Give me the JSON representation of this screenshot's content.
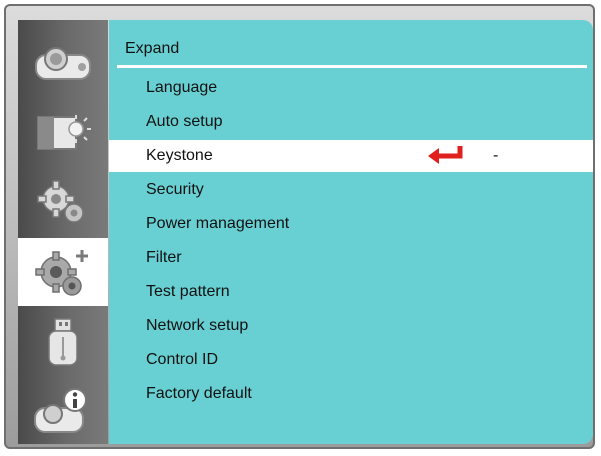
{
  "colors": {
    "panel": "#68d0d3",
    "selection": "#ffffff",
    "sidebar": "#5a5a5a",
    "enter_arrow": "#e0201c"
  },
  "sidebar": {
    "items": [
      {
        "icon": "projector-icon",
        "active": false
      },
      {
        "icon": "picture-adjust-icon",
        "active": false
      },
      {
        "icon": "settings-gear-icon",
        "active": false
      },
      {
        "icon": "expand-settings-icon",
        "active": true
      },
      {
        "icon": "usb-icon",
        "active": false
      },
      {
        "icon": "info-icon",
        "active": false
      }
    ]
  },
  "menu": {
    "title": "Expand",
    "items": [
      {
        "label": "Language"
      },
      {
        "label": "Auto setup"
      },
      {
        "label": "Keystone",
        "value": "-",
        "icon": "enter-arrow-icon",
        "selected": true
      },
      {
        "label": "Security"
      },
      {
        "label": "Power management"
      },
      {
        "label": "Filter"
      },
      {
        "label": "Test pattern"
      },
      {
        "label": "Network setup"
      },
      {
        "label": "Control ID"
      },
      {
        "label": "Factory default"
      }
    ]
  }
}
